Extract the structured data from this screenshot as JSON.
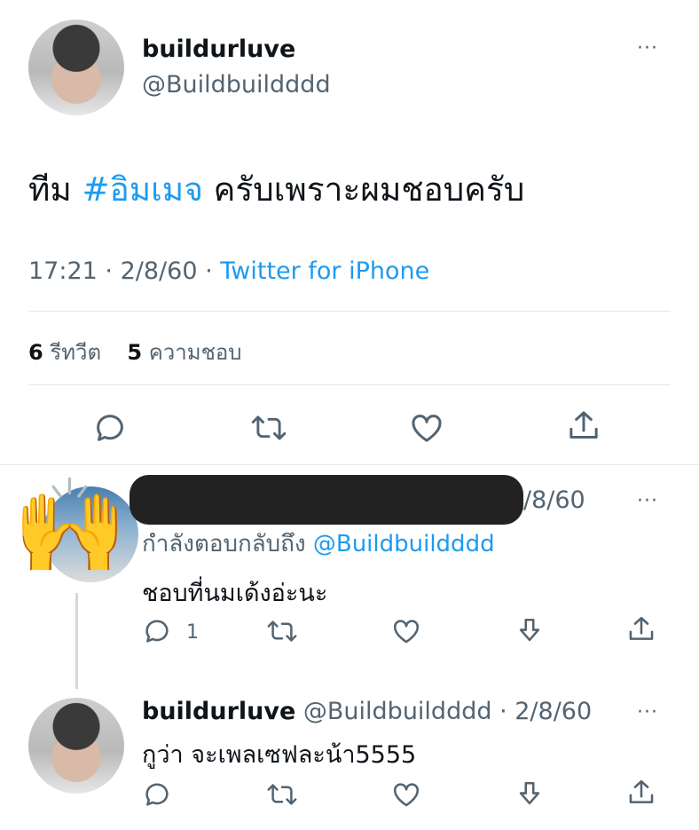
{
  "main_tweet": {
    "display_name": "buildurluve",
    "handle": "@Buildbuildddd",
    "text_before": "ทีม ",
    "hashtag": "#อิมเมจ",
    "text_after": " ครับเพราะผมชอบครับ",
    "time": "17:21",
    "date": "2/8/60",
    "source": "Twitter for iPhone",
    "separator": "·",
    "retweets_count": "6",
    "retweets_label": "รีทวีต",
    "likes_count": "5",
    "likes_label": "ความชอบ"
  },
  "reply1": {
    "date_visible": "/8/60",
    "replying_prefix": "กำลังตอบกลับถึง ",
    "replying_to": "@Buildbuildddd",
    "text": "ชอบที่นมเด้งอ่ะนะ",
    "reply_count": "1",
    "emoji": "🙌"
  },
  "reply2": {
    "display_name": "buildurluve",
    "handle_date": "@Buildbuildddd · 2/8/60",
    "text": "กูว่า จะเพลเซฟละน้า5555"
  },
  "more_glyph": "···"
}
